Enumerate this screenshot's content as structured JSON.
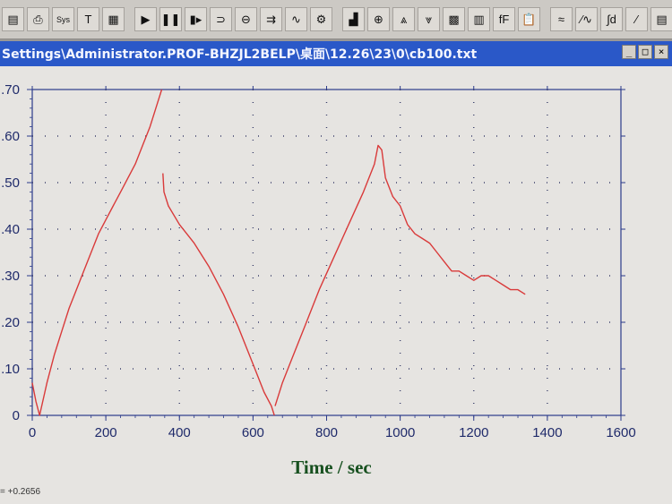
{
  "toolbar": {
    "buttons": [
      {
        "icon": "save-icon",
        "glyph": "▤"
      },
      {
        "icon": "print-icon",
        "glyph": "⎙"
      },
      {
        "icon": "sys-check-icon",
        "glyph": "Sys"
      },
      {
        "icon": "text-icon",
        "glyph": "T"
      },
      {
        "icon": "table-icon",
        "glyph": "▦"
      },
      {
        "icon": "run-icon",
        "glyph": "▶"
      },
      {
        "icon": "pause-icon",
        "glyph": "❚❚"
      },
      {
        "icon": "step-icon",
        "glyph": "▮▸"
      },
      {
        "icon": "loop-icon",
        "glyph": "⊃"
      },
      {
        "icon": "cycle-icon",
        "glyph": "⊖"
      },
      {
        "icon": "ramp-icon",
        "glyph": "⇉"
      },
      {
        "icon": "noise-icon",
        "glyph": "∿"
      },
      {
        "icon": "settings-icon",
        "glyph": "⚙"
      },
      {
        "icon": "chart-icon",
        "glyph": "▟"
      },
      {
        "icon": "zoom-icon",
        "glyph": "⊕"
      },
      {
        "icon": "peak-icon",
        "glyph": "⩓"
      },
      {
        "icon": "peak2-icon",
        "glyph": "⩔"
      },
      {
        "icon": "grid-icon",
        "glyph": "▩"
      },
      {
        "icon": "color-icon",
        "glyph": "▥"
      },
      {
        "icon": "font-icon",
        "glyph": "fF"
      },
      {
        "icon": "clipboard-icon",
        "glyph": "📋"
      },
      {
        "icon": "baseline-icon",
        "glyph": "≈"
      },
      {
        "icon": "wave-icon",
        "glyph": "⁄∿"
      },
      {
        "icon": "integral-icon",
        "glyph": "∫d"
      },
      {
        "icon": "slope-icon",
        "glyph": "⁄"
      },
      {
        "icon": "menu-icon",
        "glyph": "▤"
      }
    ]
  },
  "window": {
    "title": "Settings\\Administrator.PROF-BHZJL2BELP\\桌面\\12.26\\23\\0\\cb100.txt",
    "minimize": "_",
    "maximize": "□",
    "close": "×"
  },
  "status": {
    "readout": "= +0.2656"
  },
  "chart_data": {
    "type": "line",
    "xlabel": "Time / sec",
    "ylabel": "",
    "xlim": [
      0,
      1600
    ],
    "ylim": [
      0,
      0.7
    ],
    "x_ticks": [
      0,
      200,
      400,
      600,
      800,
      1000,
      1200,
      1400,
      1600
    ],
    "y_ticks": [
      0,
      0.1,
      0.2,
      0.3,
      0.4,
      0.5,
      0.6,
      0.7
    ],
    "y_tick_labels": [
      "0",
      ".10",
      ".20",
      ".30",
      ".40",
      ".50",
      ".60",
      ".70"
    ],
    "grid": "dotted",
    "series_color": "#d93a3a",
    "series": [
      {
        "x": [
          0,
          10,
          20,
          40,
          60,
          80,
          100,
          120,
          140,
          160,
          180,
          200,
          220,
          240,
          260,
          280,
          300,
          320,
          340,
          352
        ],
        "values": [
          0.07,
          0.03,
          0.0,
          0.07,
          0.13,
          0.18,
          0.23,
          0.27,
          0.31,
          0.35,
          0.39,
          0.42,
          0.45,
          0.48,
          0.51,
          0.54,
          0.58,
          0.62,
          0.67,
          0.7
        ]
      },
      {
        "x": [
          355,
          358,
          370,
          400,
          440,
          480,
          520,
          560,
          600,
          630,
          650,
          658
        ],
        "values": [
          0.52,
          0.48,
          0.45,
          0.41,
          0.37,
          0.32,
          0.26,
          0.19,
          0.11,
          0.05,
          0.02,
          0.0
        ]
      },
      {
        "x": [
          660,
          680,
          700,
          740,
          780,
          820,
          860,
          900,
          930,
          940,
          950,
          960,
          980,
          1000,
          1020,
          1040,
          1060,
          1080,
          1100,
          1120,
          1140,
          1160,
          1180,
          1200,
          1220,
          1240,
          1260,
          1280,
          1300,
          1320,
          1340
        ],
        "values": [
          0.02,
          0.07,
          0.11,
          0.19,
          0.27,
          0.34,
          0.41,
          0.48,
          0.54,
          0.58,
          0.57,
          0.51,
          0.47,
          0.45,
          0.41,
          0.39,
          0.38,
          0.37,
          0.35,
          0.33,
          0.31,
          0.31,
          0.3,
          0.29,
          0.3,
          0.3,
          0.29,
          0.28,
          0.27,
          0.27,
          0.26
        ]
      }
    ]
  }
}
